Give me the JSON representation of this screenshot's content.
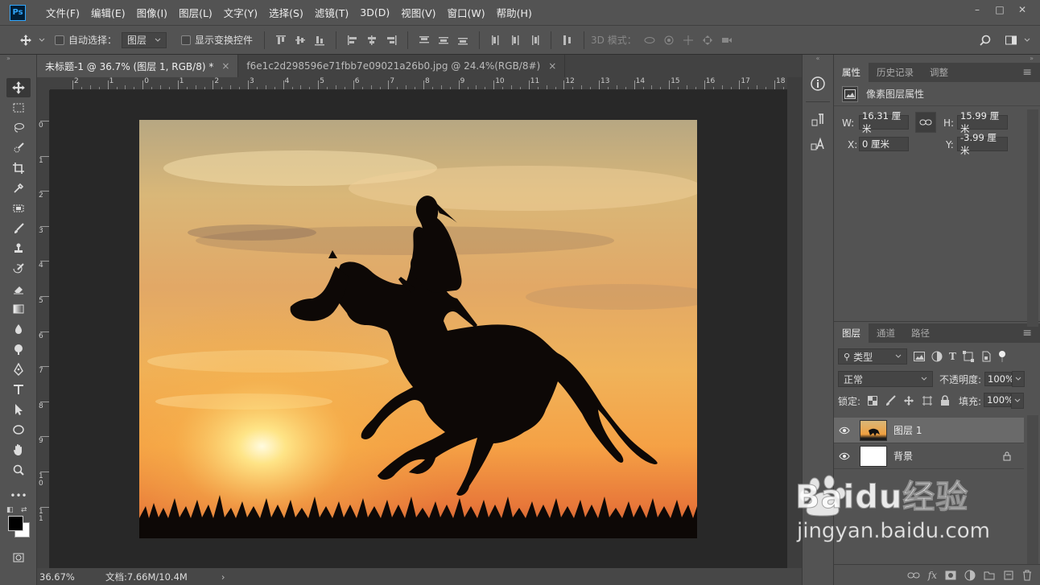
{
  "app": {
    "logo_text": "Ps"
  },
  "menu": [
    "文件(F)",
    "编辑(E)",
    "图像(I)",
    "图层(L)",
    "文字(Y)",
    "选择(S)",
    "滤镜(T)",
    "3D(D)",
    "视图(V)",
    "窗口(W)",
    "帮助(H)"
  ],
  "window_controls": {
    "minimize": "–",
    "maximize": "□",
    "close": "✕"
  },
  "options_bar": {
    "auto_select_label": "自动选择：",
    "auto_select_value": "图层",
    "show_transform_label": "显示变换控件",
    "mode_3d_label": "3D 模式："
  },
  "tabs": [
    {
      "title": "未标题-1 @ 36.7% (图层 1, RGB/8) *",
      "close": "×"
    },
    {
      "title": "f6e1c2d298596e71fbb7e09021a26b0.jpg @ 24.4%(RGB/8#)",
      "close": "×"
    }
  ],
  "ruler": {
    "h_ticks": [
      "2",
      "1",
      "0",
      "1",
      "2",
      "3",
      "4",
      "5",
      "6",
      "7",
      "8",
      "9",
      "10",
      "11",
      "12",
      "13",
      "14",
      "15",
      "16",
      "17",
      "18"
    ],
    "v_ticks": [
      "0",
      "1",
      "2",
      "3",
      "4",
      "5",
      "6",
      "7",
      "8",
      "9",
      "1\n0",
      "1\n1"
    ]
  },
  "status": {
    "zoom": "36.67%",
    "doc": "文档:7.66M/10.4M",
    "arrow": "›"
  },
  "properties": {
    "tabs": [
      "属性",
      "历史记录",
      "调整"
    ],
    "header": "像素图层属性",
    "w_label": "W:",
    "w_value": "16.31 厘米",
    "h_label": "H:",
    "h_value": "15.99 厘米",
    "x_label": "X:",
    "x_value": "0 厘米",
    "y_label": "Y:",
    "y_value": "-3.99 厘米"
  },
  "layers": {
    "tabs": [
      "图层",
      "通道",
      "路径"
    ],
    "filter_label": "类型",
    "blend_mode": "正常",
    "opacity_label": "不透明度:",
    "opacity_value": "100%",
    "lock_label": "锁定:",
    "fill_label": "填充:",
    "fill_value": "100%",
    "items": [
      {
        "name": "图层 1",
        "selected": true
      },
      {
        "name": "背景",
        "selected": false
      }
    ],
    "bottom_icons": [
      "link-icon",
      "fx-icon",
      "mask-icon",
      "adjustment-icon",
      "group-icon",
      "new-layer-icon",
      "trash-icon"
    ]
  },
  "watermark": {
    "brand": "Baidu经验",
    "url": "jingyan.baidu.com"
  },
  "colors": {
    "panel": "#535353",
    "dark": "#424242",
    "workspace": "#282828",
    "selected_layer": "#6a6a6a"
  }
}
